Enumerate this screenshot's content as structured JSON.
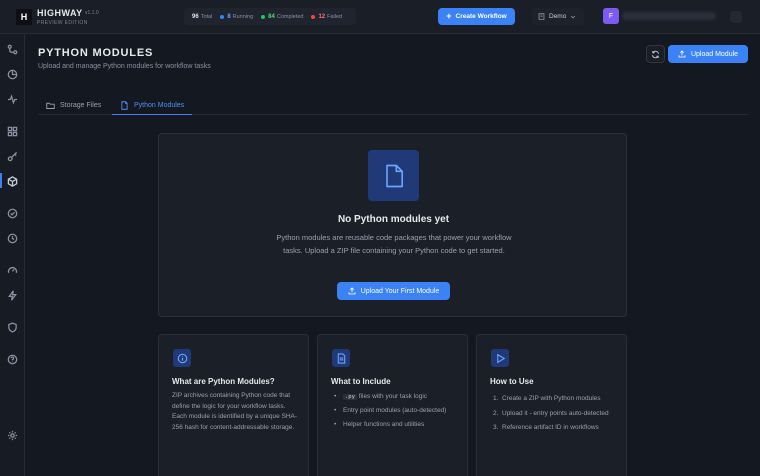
{
  "app": {
    "logo_letter": "H",
    "brand": "HIGHWAY",
    "version": "v1.1.0",
    "edition": "PREVIEW EDITION"
  },
  "stats": {
    "total_value": "96",
    "total_label": "Total",
    "running_value": "8",
    "running_label": "Running",
    "completed_value": "84",
    "completed_label": "Completed",
    "failed_value": "12",
    "failed_label": "Failed",
    "colors": {
      "running": "#3b82f6",
      "completed": "#22c55e",
      "failed": "#ef4444"
    }
  },
  "topbar": {
    "create_label": "Create Workflow",
    "env_label": "Demo",
    "user_initial": "F"
  },
  "sidebar": {
    "items": [
      "workflows-icon",
      "dashboard-icon",
      "activity-icon",
      "apps-icon",
      "key-icon",
      "modules-icon",
      "check-icon",
      "history-icon",
      "gauge-icon",
      "bolt-icon",
      "shield-icon",
      "help-icon",
      "settings-icon"
    ],
    "active": "modules-icon"
  },
  "header": {
    "title": "PYTHON MODULES",
    "subtitle": "Upload and manage Python modules for workflow tasks",
    "upload_label": "Upload Module"
  },
  "tabs": [
    {
      "label": "Storage Files",
      "active": false
    },
    {
      "label": "Python Modules",
      "active": true
    }
  ],
  "empty_state": {
    "title": "No Python modules yet",
    "desc": "Python modules are reusable code packages that power your workflow tasks. Upload a ZIP file containing your Python code to get started.",
    "button_label": "Upload Your First Module"
  },
  "info_cards": {
    "what": {
      "title": "What are Python Modules?",
      "body": "ZIP archives containing Python code that define the logic for your workflow tasks. Each module is identified by a unique SHA-256 hash for content-addressable storage."
    },
    "include": {
      "title": "What to Include",
      "code": ".py",
      "item1_rest": " files with your task logic",
      "item2": "Entry point modules (auto-detected)",
      "item3": "Helper functions and utilities"
    },
    "how": {
      "title": "How to Use",
      "step1": "Create a ZIP with Python modules",
      "step2": "Upload it - entry points auto-detected",
      "step3": "Reference artifact ID in workflows"
    }
  },
  "accent_color": "#3b82f6"
}
